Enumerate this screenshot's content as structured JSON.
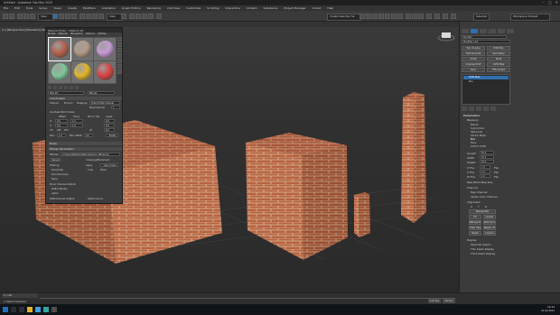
{
  "window": {
    "title": "Untitled - Autodesk 3ds Max 2020",
    "controls": [
      "–",
      "□",
      "✕"
    ]
  },
  "menubar": [
    "File",
    "Edit",
    "Tools",
    "Group",
    "Views",
    "Create",
    "Modifiers",
    "Animation",
    "Graph Editors",
    "Rendering",
    "Civil View",
    "Customize",
    "Scripting",
    "Interactive",
    "Content",
    "Substance",
    "Project Manager",
    "Arnold",
    "Help"
  ],
  "toolbar": {
    "view_select": "View",
    "selection_set": "Create Selection Se",
    "workspace": "Workspace: Default"
  },
  "viewport": {
    "label": "[+] [Perspective] [Standard] [Default Shading]"
  },
  "material_editor": {
    "title": "Material Editor - Material #1",
    "menu": [
      "Modes",
      "Material",
      "Navigation",
      "Options",
      "Utilities"
    ],
    "slot_colors": [
      "#b7604a",
      "#b49a86",
      "#c79ad6",
      "#7fc79a",
      "#e3b52a",
      "#d84242"
    ],
    "material_name": "Map #1",
    "material_type": "Bitmap",
    "rollouts": {
      "coordinates": "Coordinates",
      "noise": "Noise",
      "bitmap_params": "Bitmap Parameters"
    },
    "coords": {
      "texture": "Texture",
      "environ": "Environ",
      "mapping": "Explicit Map Channel",
      "map_channel_label": "Map Channel:",
      "map_channel": "1",
      "use_real_world": "Use Real-World Scale",
      "offset_label": "Offset",
      "tiling_label": "Tiling",
      "mirror_tile": "Mirror Tile",
      "angle_label": "Angle",
      "u_label": "U:",
      "v_label": "V:",
      "w_label": "W:",
      "u_offset": "0.0",
      "v_offset": "0.0",
      "u_tiling": "1.0",
      "v_tiling": "1.0",
      "u_angle": "0.0",
      "v_angle": "0.0",
      "w_angle": "0.0",
      "uv_options": [
        "UV",
        "VW",
        "WU"
      ],
      "blur_label": "Blur:",
      "blur": "1.0",
      "blur_offset_label": "Blur offset:",
      "blur_offset": "0.0",
      "rotate": "Rotate"
    },
    "bitmap": {
      "bitmap_label": "Bitmap:",
      "path": "C:\\Users\\Desktop\\Textures\\brick_diffuse.jpg",
      "reload": "Reload",
      "cropping_label": "Cropping/Placement",
      "apply": "Apply",
      "view_image": "View Image",
      "filtering_label": "Filtering",
      "pyramidal": "Pyramidal",
      "summed_area": "Summed Area",
      "none": "None",
      "crop": "Crop",
      "place": "Place",
      "mono_label": "Mono Channel Output:",
      "rgb_intensity": "RGB Intensity",
      "alpha": "Alpha",
      "rgb_channel_label": "RGB Channel Output:",
      "alpha_source_label": "Alpha Source"
    }
  },
  "command_panel": {
    "tabs": [
      "create-tab",
      "modify-tab",
      "hierarchy-tab",
      "motion-tab",
      "display-tab",
      "utilities-tab"
    ],
    "object_name": "Box001",
    "modifier_list": "Modifier List",
    "buttons": [
      "Turn to poly",
      "Edit Poly",
      "Turbosmooth",
      "Symmetry",
      "Cloth",
      "Shell",
      "Unwrap UVW",
      "UVW Map",
      "Slice",
      "FFD 4x4x4"
    ],
    "stack": [
      "UVW Map",
      "Box"
    ],
    "parameters_label": "Parameters",
    "mapping_label": "Mapping:",
    "mapping_options": [
      "Planar",
      "Cylindrical",
      "Spherical",
      "Shrink Wrap",
      "Box",
      "Face",
      "XYZ to UVW"
    ],
    "length_label": "Length:",
    "width_label": "Width:",
    "height_label": "Height:",
    "length": "50.0",
    "width": "50.0",
    "height": "50.0",
    "u_tile_label": "U Tile:",
    "v_tile_label": "V Tile:",
    "w_tile_label": "W Tile:",
    "u_tile": "1.0",
    "v_tile": "1.0",
    "w_tile": "1.0",
    "flip": "Flip",
    "real_world": "Real-World Map Size",
    "channel_label": "Channel:",
    "map_channel": "Map Channel:",
    "vertex_color": "Vertex Color Channel",
    "alignment_label": "Alignment:",
    "axes": [
      "X",
      "Y",
      "Z"
    ],
    "manipulate": "Manipulate",
    "fit": "Fit",
    "center": "Center",
    "bitmap_fit": "Bitmap Fit",
    "normal_align": "Normal Align",
    "view_align": "View Align",
    "region_fit": "Region Fit",
    "reset": "Reset",
    "acquire": "Acquire",
    "display_label": "Display:",
    "display_options": [
      "Show No Seams",
      "Thin Seam Display",
      "Thick Seam Display"
    ]
  },
  "status": {
    "objects": "1 Object Selected",
    "frame_counter": "0 / 100",
    "auto_key": "Auto Key",
    "set_key": "Set Key",
    "selected": "Selected"
  },
  "taskbar": {
    "time": "14:12",
    "date": "01.02.2021"
  }
}
